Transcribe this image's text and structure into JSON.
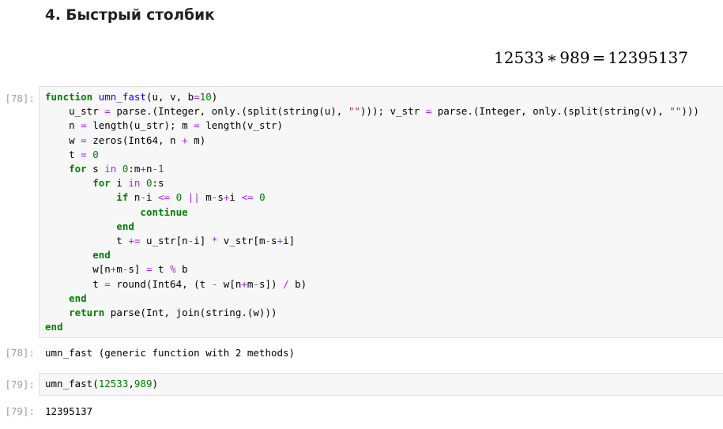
{
  "heading": "4. Быстрый столбик",
  "math": {
    "lhs": "12533",
    "op1": "∗",
    "mid": "989",
    "op2": "=",
    "rhs": "12395137"
  },
  "cells": [
    {
      "in_prompt": "[78]:",
      "out_prompt": "[78]:",
      "output": "umn_fast (generic function with 2 methods)",
      "code_lines": [
        "function umn_fast(u, v, b=10)",
        "    u_str = parse.(Integer, only.(split(string(u), \"\"))); v_str = parse.(Integer, only.(split(string(v), \"\")))",
        "    n = length(u_str); m = length(v_str)",
        "    w = zeros(Int64, n + m)",
        "    t = 0",
        "    for s in 0:m+n-1",
        "        for i in 0:s",
        "            if n-i <= 0 || m-s+i <= 0",
        "                continue",
        "            end",
        "            t += u_str[n-i] * v_str[m-s+i]",
        "        end",
        "        w[n+m-s] = t % b",
        "        t = round(Int64, (t - w[n+m-s]) / b)",
        "    end",
        "    return parse(Int, join(string.(w)))",
        "end"
      ]
    },
    {
      "in_prompt": "[79]:",
      "out_prompt": "[79]:",
      "code": "umn_fast(12533,989)",
      "output": "12395137"
    }
  ],
  "colors": {
    "keyword": "#008000",
    "operator": "#aa22ff",
    "function_name": "#0000ff",
    "string": "#ba2121",
    "prompt": "#9e9e9e",
    "cell_bg": "#f7f7f7"
  }
}
